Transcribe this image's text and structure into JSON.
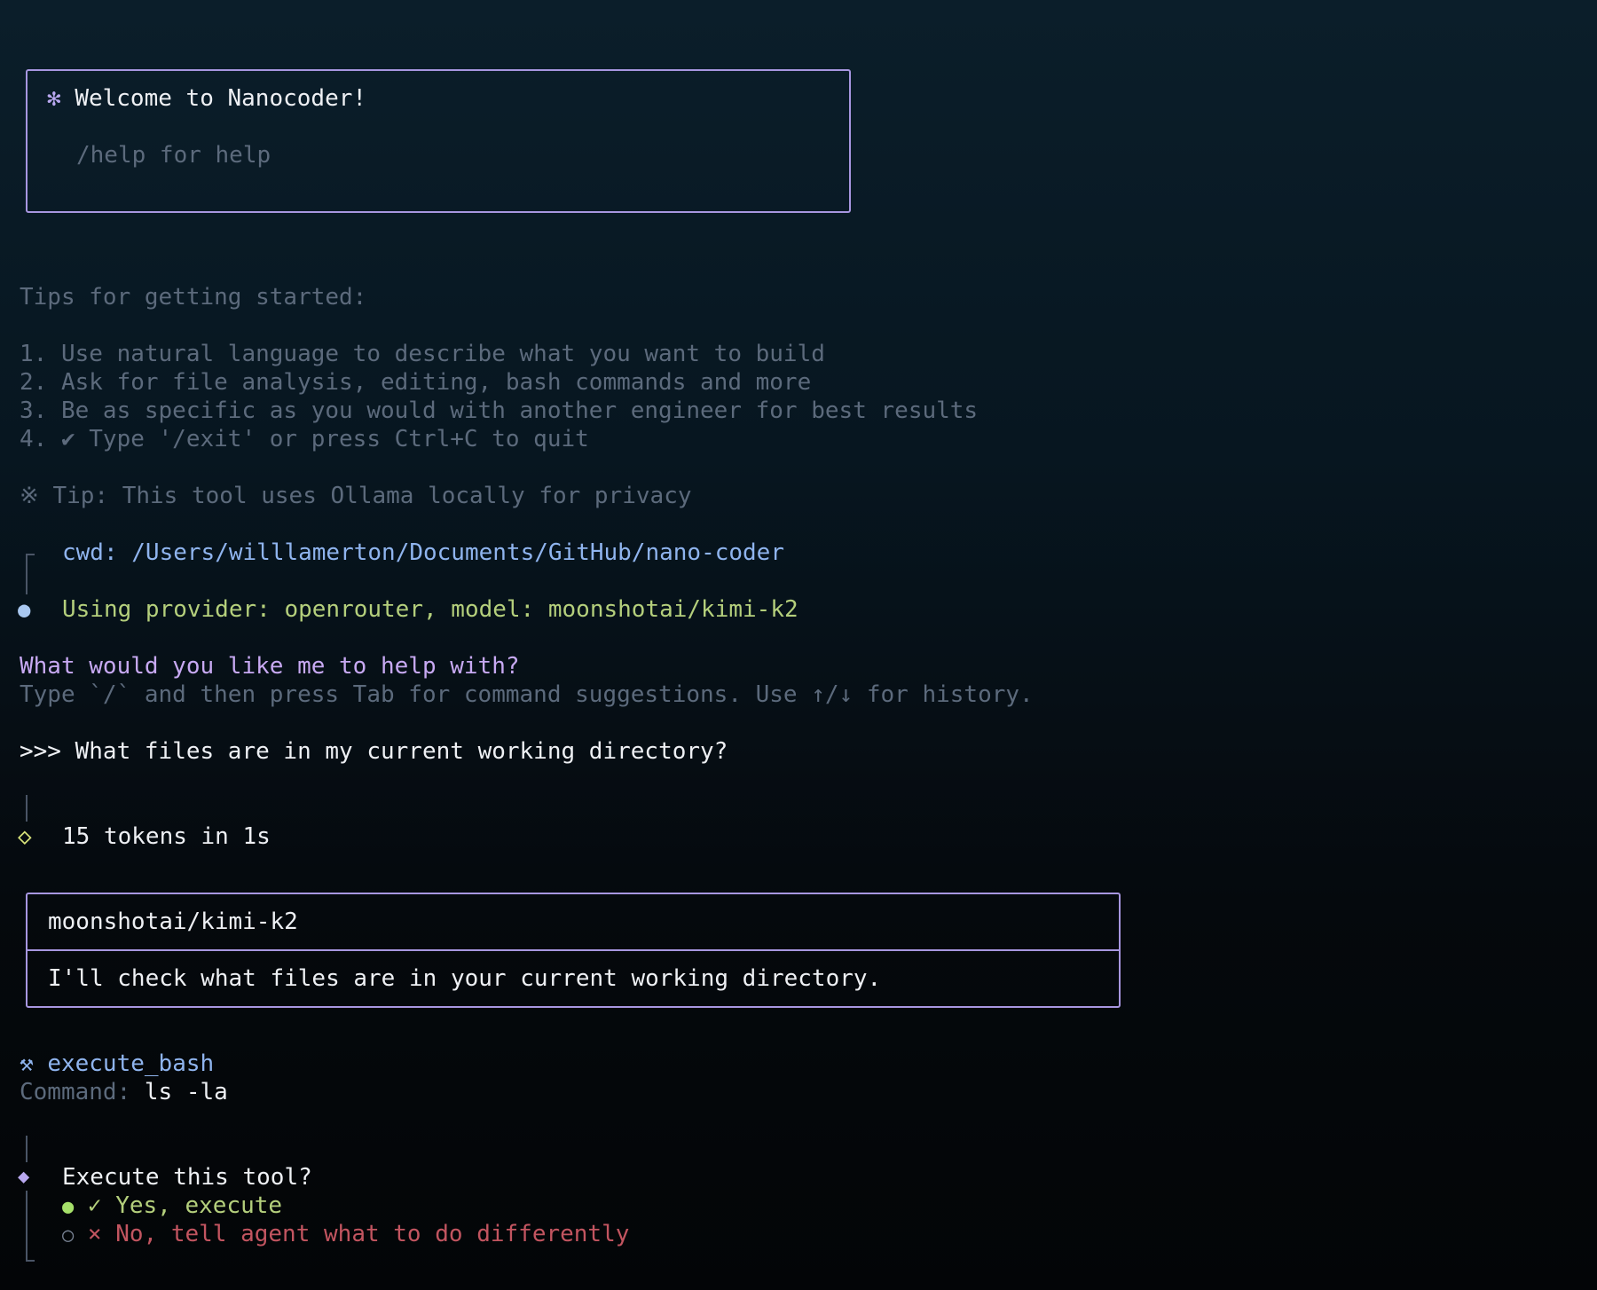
{
  "welcome": {
    "icon": "✻",
    "title": "Welcome to Nanocoder!",
    "help": "/help for help"
  },
  "tips": {
    "heading": "Tips for getting started:",
    "items": [
      "1. Use natural language to describe what you want to build",
      "2. Ask for file analysis, editing, bash commands and more",
      "3. Be as specific as you would with another engineer for best results",
      "4. ✔ Type '/exit' or press Ctrl+C to quit"
    ],
    "tip_icon": "※",
    "tip_text": "Tip: This tool uses Ollama locally for privacy"
  },
  "status": {
    "cwd_label": "cwd:",
    "cwd_path": "/Users/willlamerton/Documents/GitHub/nano-coder",
    "provider_text": "Using provider: openrouter, model: moonshotai/kimi-k2"
  },
  "prompt": {
    "question": "What would you like me to help with?",
    "hint": "Type `/` and then press Tab for command suggestions. Use ↑/↓ for history."
  },
  "conversation": {
    "user_prefix": ">>>",
    "user_message": "What files are in my current working directory?",
    "token_icon": "◇",
    "token_stats": "15 tokens in 1s",
    "model_name": "moonshotai/kimi-k2",
    "assistant_message": "I'll check what files are in your current working directory."
  },
  "tool": {
    "icon": "⚒",
    "name": "execute_bash",
    "command_label": "Command:",
    "command_value": "ls -la",
    "confirm_icon": "◆",
    "confirm_question": "Execute this tool?",
    "options": [
      {
        "bullet": "●",
        "label": "✓ Yes, execute",
        "selected": true
      },
      {
        "bullet": "○",
        "label": "× No, tell agent what to do differently",
        "selected": false
      }
    ]
  },
  "colors": {
    "accent_border": "#a796e0",
    "cwd": "#8fb4ee",
    "provider": "#b4cf7c",
    "question": "#c7a9f2",
    "yes": "#b4cf7c",
    "no": "#c25560"
  }
}
